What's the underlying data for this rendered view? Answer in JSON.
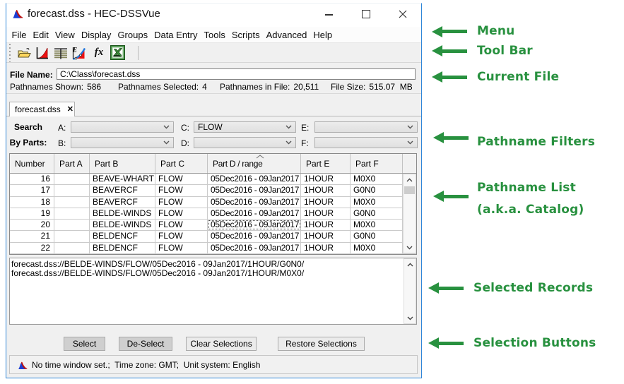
{
  "colors": {
    "window_border": "#2f86d8",
    "annotation_green": "#28913f",
    "panel_gray": "#f0f0f0"
  },
  "window": {
    "title": "forecast.dss - HEC-DSSVue",
    "controls": {
      "minimize": "minimize",
      "maximize": "maximize",
      "close": "close"
    },
    "menu": [
      "File",
      "Edit",
      "View",
      "Display",
      "Groups",
      "Data Entry",
      "Tools",
      "Scripts",
      "Advanced",
      "Help"
    ],
    "toolbar": {
      "icons": [
        "open-file-icon",
        "plot-icon",
        "tabulate-icon",
        "math-functions-icon",
        "fx-icon",
        "excel-icon"
      ],
      "fx_label": "fx"
    },
    "file_panel": {
      "label": "File Name:",
      "value": "C:\\Class\\forecast.dss",
      "stats": [
        {
          "label": "Pathnames Shown:",
          "value": "586"
        },
        {
          "label": "Pathnames Selected:",
          "value": "4"
        },
        {
          "label": "Pathnames in File:",
          "value": "20,511"
        },
        {
          "label": "File Size:",
          "value": "515.07  MB"
        }
      ]
    },
    "tab": {
      "label": "forecast.dss",
      "close": "✕"
    },
    "filters": {
      "row1_label": "Search",
      "row2_label": "By Parts:",
      "combos": [
        {
          "key": "A:",
          "value": ""
        },
        {
          "key": "C:",
          "value": "FLOW"
        },
        {
          "key": "E:",
          "value": ""
        },
        {
          "key": "B:",
          "value": ""
        },
        {
          "key": "D:",
          "value": ""
        },
        {
          "key": "F:",
          "value": ""
        }
      ]
    },
    "table": {
      "columns": [
        "Number",
        "Part A",
        "Part B",
        "Part C",
        "Part D / range",
        "Part E",
        "Part F"
      ],
      "sorted_column": "Part D / range",
      "rows": [
        {
          "number": "16",
          "a": "",
          "b": "BEAVE-WHART",
          "c": "FLOW",
          "d": "05Dec2016 - 09Jan2017",
          "e": "1HOUR",
          "f": "M0X0"
        },
        {
          "number": "17",
          "a": "",
          "b": "BEAVERCF",
          "c": "FLOW",
          "d": "05Dec2016 - 09Jan2017",
          "e": "1HOUR",
          "f": "G0N0"
        },
        {
          "number": "18",
          "a": "",
          "b": "BEAVERCF",
          "c": "FLOW",
          "d": "05Dec2016 - 09Jan2017",
          "e": "1HOUR",
          "f": "M0X0"
        },
        {
          "number": "19",
          "a": "",
          "b": "BELDE-WINDS",
          "c": "FLOW",
          "d": "05Dec2016 - 09Jan2017",
          "e": "1HOUR",
          "f": "G0N0"
        },
        {
          "number": "20",
          "a": "",
          "b": "BELDE-WINDS",
          "c": "FLOW",
          "d": "05Dec2016 - 09Jan2017",
          "e": "1HOUR",
          "f": "M0X0"
        },
        {
          "number": "21",
          "a": "",
          "b": "BELDENCF",
          "c": "FLOW",
          "d": "05Dec2016 - 09Jan2017",
          "e": "1HOUR",
          "f": "G0N0"
        },
        {
          "number": "22",
          "a": "",
          "b": "BELDENCF",
          "c": "FLOW",
          "d": "05Dec2016 - 09Jan2017",
          "e": "1HOUR",
          "f": "M0X0"
        }
      ]
    },
    "selected_records": [
      "forecast.dss://BELDE-WINDS/FLOW/05Dec2016 - 09Jan2017/1HOUR/G0N0/",
      "forecast.dss://BELDE-WINDS/FLOW/05Dec2016 - 09Jan2017/1HOUR/M0X0/"
    ],
    "selection_buttons": [
      "Select",
      "De-Select",
      "Clear Selections",
      "Restore Selections"
    ],
    "status": "No time window set.;  Time zone: GMT;  Unit system: English"
  },
  "annotations": [
    {
      "label": "Menu"
    },
    {
      "label": "Tool Bar"
    },
    {
      "label": "Current File"
    },
    {
      "label": "Pathname Filters"
    },
    {
      "label": "Pathname List",
      "sub": "(a.k.a. Catalog)"
    },
    {
      "label": "Selected Records"
    },
    {
      "label": "Selection Buttons"
    }
  ]
}
